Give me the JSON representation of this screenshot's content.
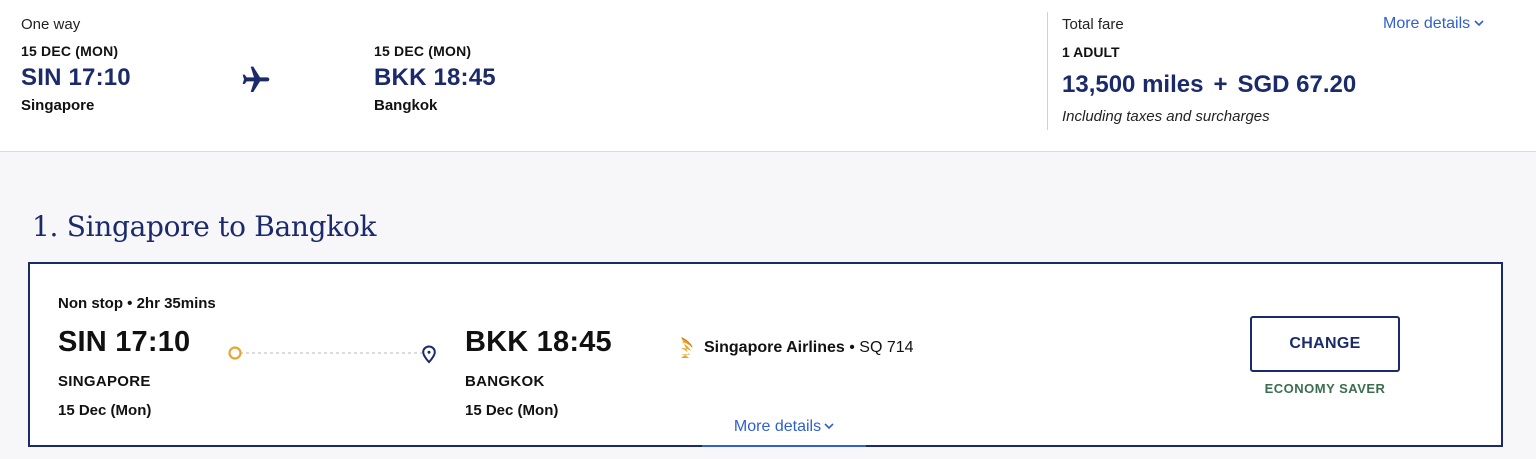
{
  "summary": {
    "trip_type": "One way",
    "departure": {
      "date": "15 DEC (MON)",
      "code_time": "SIN 17:10",
      "city": "Singapore"
    },
    "arrival": {
      "date": "15 DEC (MON)",
      "code_time": "BKK 18:45",
      "city": "Bangkok"
    },
    "fare": {
      "label": "Total fare",
      "passengers": "1 ADULT",
      "miles": "13,500 miles",
      "plus": "+",
      "cash": "SGD 67.20",
      "note": "Including taxes and surcharges"
    },
    "more_details": "More details"
  },
  "segment": {
    "title": "1. Singapore to Bangkok",
    "duration": "Non stop • 2hr 35mins",
    "departure": {
      "code_time": "SIN 17:10",
      "city": "SINGAPORE",
      "date": "15 Dec (Mon)"
    },
    "arrival": {
      "code_time": "BKK 18:45",
      "city": "BANGKOK",
      "date": "15 Dec (Mon)"
    },
    "airline": {
      "name": "Singapore Airlines",
      "flight": " • SQ 714"
    },
    "change_label": "CHANGE",
    "cabin": "ECONOMY SAVER",
    "more_details": "More details"
  },
  "icons": {
    "plane": "airplane-icon",
    "origin": "origin-circle-icon",
    "destination": "location-pin-icon",
    "airline_logo": "singapore-airlines-logo",
    "chevron": "chevron-down-icon"
  },
  "colors": {
    "brand_navy": "#1b2a6b",
    "link_blue": "#2f5fd0",
    "origin_gold": "#e8a531",
    "cabin_green": "#3b6e4f"
  }
}
